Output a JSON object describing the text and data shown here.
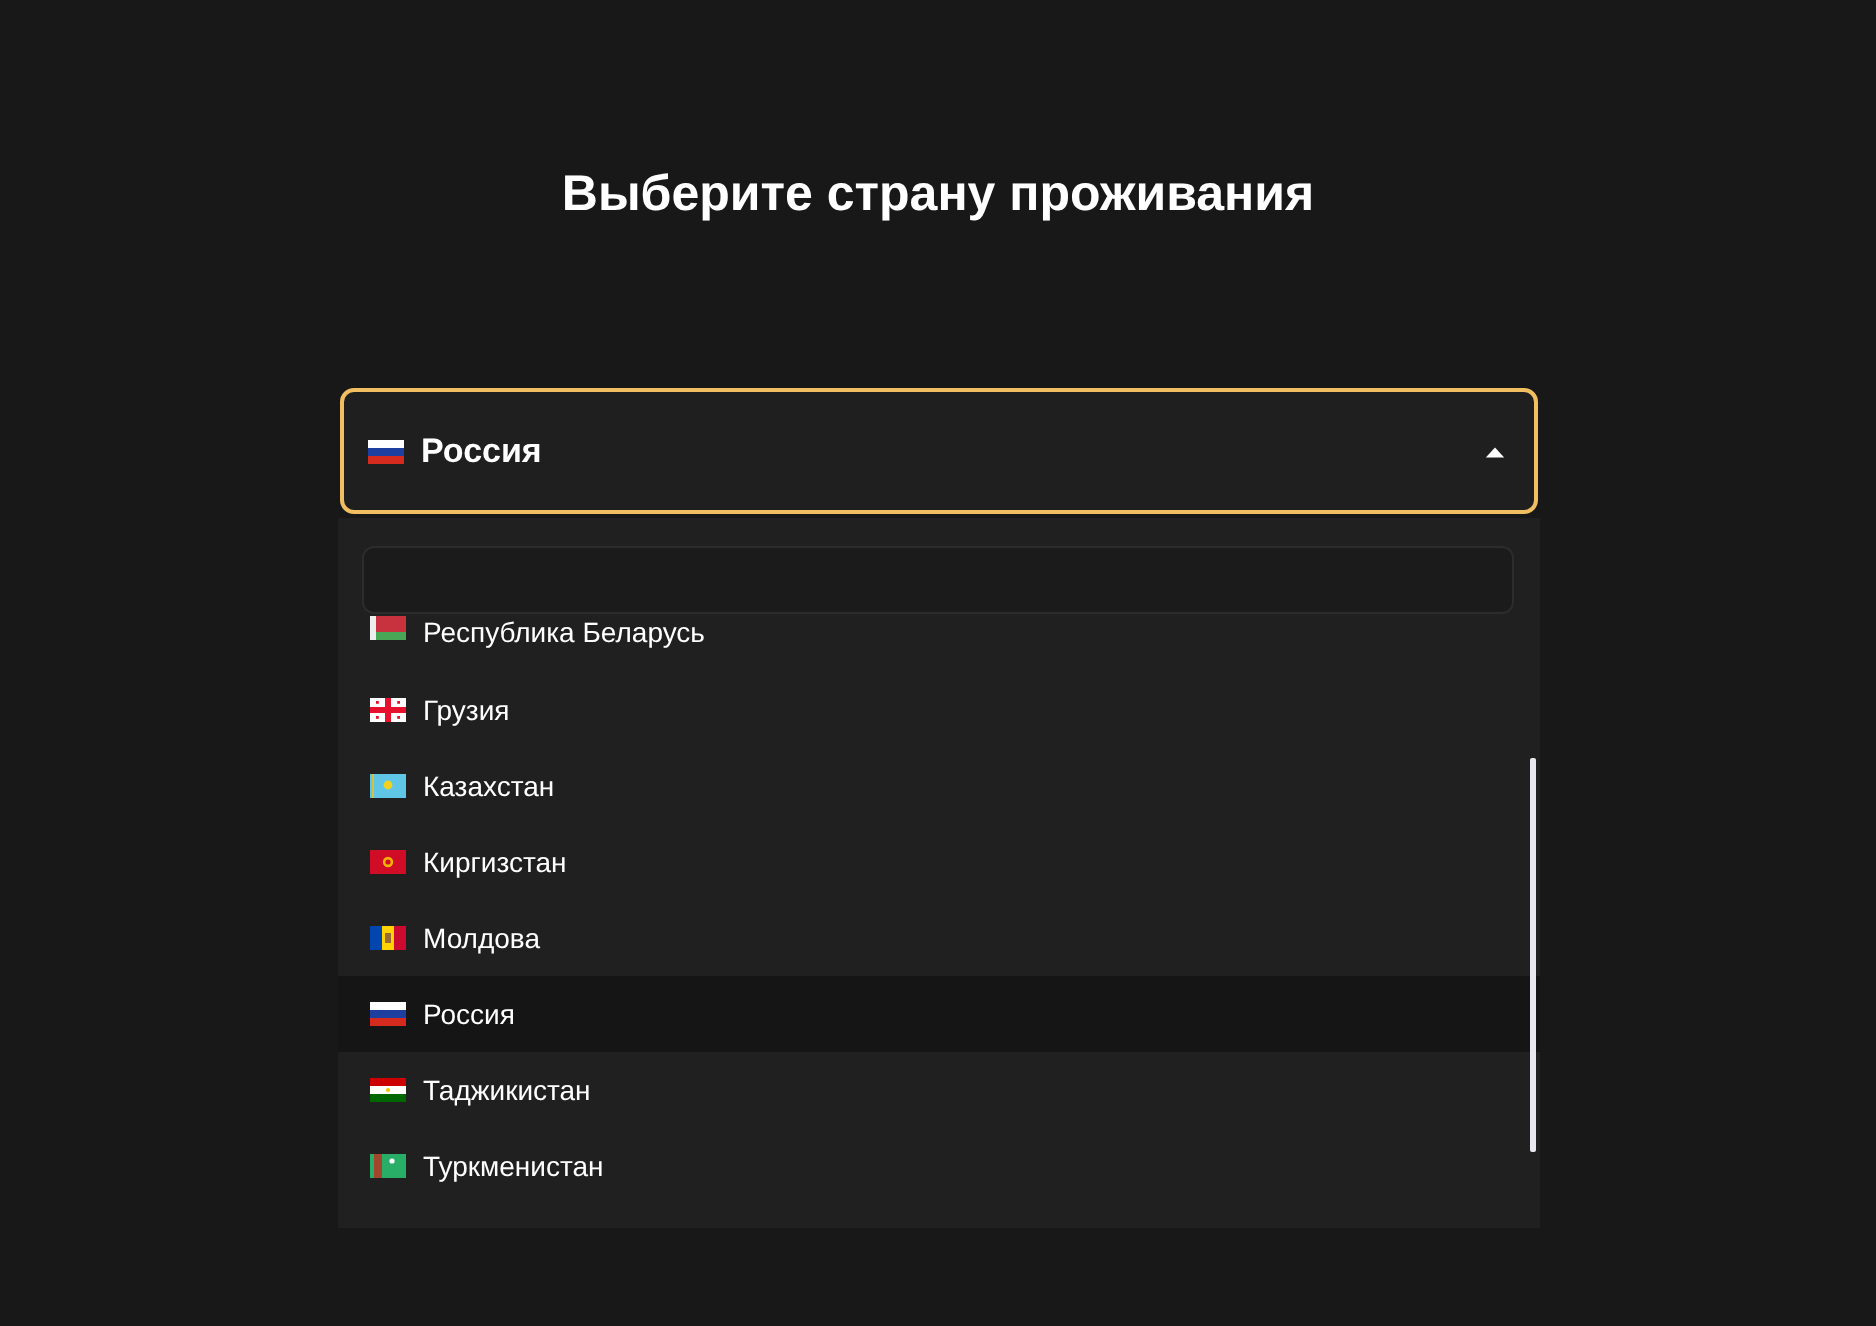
{
  "title": "Выберите страну проживания",
  "select": {
    "value": "Россия",
    "kind": "ru",
    "expanded": true
  },
  "options": [
    {
      "label": "Республика Беларусь",
      "kind": "by",
      "selected": false
    },
    {
      "label": "Грузия",
      "kind": "ge",
      "selected": false
    },
    {
      "label": "Казахстан",
      "kind": "kz",
      "selected": false
    },
    {
      "label": "Киргизстан",
      "kind": "kg",
      "selected": false
    },
    {
      "label": "Молдова",
      "kind": "md",
      "selected": false
    },
    {
      "label": "Россия",
      "kind": "ru",
      "selected": true
    },
    {
      "label": "Таджикистан",
      "kind": "tj",
      "selected": false
    },
    {
      "label": "Туркменистан",
      "kind": "tm",
      "selected": false
    }
  ]
}
